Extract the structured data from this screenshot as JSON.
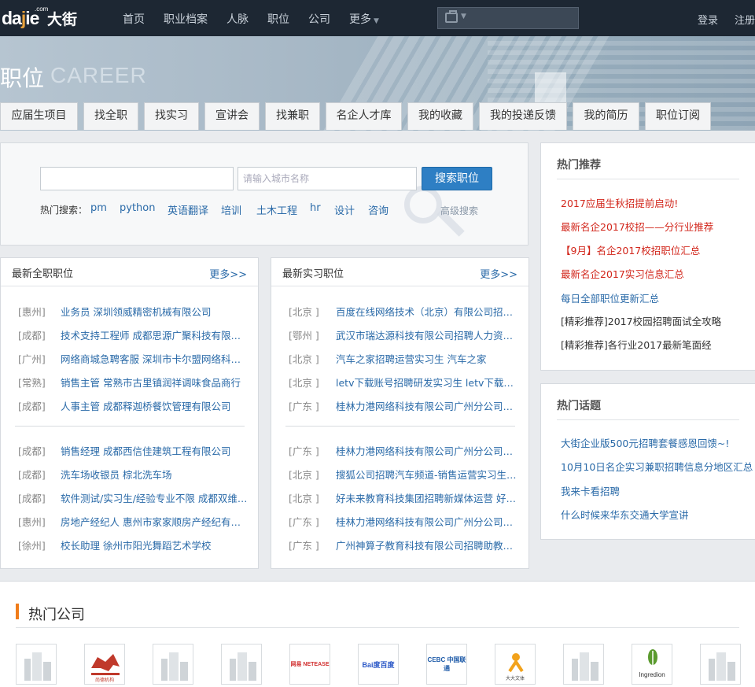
{
  "header": {
    "logo_en": "dajie",
    "logo_com": ".com",
    "logo_cn": "大街",
    "nav": [
      "首页",
      "职业档案",
      "人脉",
      "职位",
      "公司",
      "更多"
    ],
    "login": "登录",
    "register": "注册"
  },
  "banner": {
    "title": "职位",
    "subtitle": "CAREER",
    "tabs": [
      "应届生项目",
      "找全职",
      "找实习",
      "宣讲会",
      "找兼职",
      "名企人才库",
      "我的收藏",
      "我的投递反馈",
      "我的简历",
      "职位订阅"
    ]
  },
  "search": {
    "city_placeholder": "请输入城市名称",
    "button": "搜索职位",
    "hot_label": "热门搜索：",
    "hot_keywords": [
      "pm",
      "python",
      "英语翻译",
      "培训",
      "土木工程",
      "hr",
      "设计",
      "咨询"
    ],
    "advanced": "高级搜索"
  },
  "fulltime": {
    "title": "最新全职职位",
    "more": "更多>>",
    "rows": [
      {
        "city": "[惠州]",
        "job": "业务员  深圳领威精密机械有限公司"
      },
      {
        "city": "[成都]",
        "job": "技术支持工程师  成都思源广聚科技有限公司"
      },
      {
        "city": "[广州]",
        "job": "网络商城急聘客服  深圳市卡尔盟网络科技有限公司"
      },
      {
        "city": "[常熟]",
        "job": "销售主管  常熟市古里镇润祥调味食品商行"
      },
      {
        "city": "[成都]",
        "job": "人事主管  成都释迦桥餐饮管理有限公司"
      },
      {
        "city": "[成都]",
        "job": "销售经理  成都西信佳建筑工程有限公司"
      },
      {
        "city": "[成都]",
        "job": "洗车场收银员  棕北洗车场"
      },
      {
        "city": "[成都]",
        "job": "软件测试/实习生/经验专业不限  成都双维科技有限公司"
      },
      {
        "city": "[惠州]",
        "job": "房地产经纪人  惠州市家家顺房产经纪有限公司"
      },
      {
        "city": "[徐州]",
        "job": "校长助理  徐州市阳光舞蹈艺术学校"
      }
    ]
  },
  "intern": {
    "title": "最新实习职位",
    "more": "更多>>",
    "rows": [
      {
        "city": "[北京 ]",
        "job": "百度在线网络技术（北京）有限公司招聘实习生"
      },
      {
        "city": "[鄂州 ]",
        "job": "武汉市瑞达源科技有限公司招聘人力资源实习生"
      },
      {
        "city": "[北京 ]",
        "job": "汽车之家招聘运营实习生  汽车之家"
      },
      {
        "city": "[北京 ]",
        "job": "letv下载账号招聘研发实习生  letv下载账号"
      },
      {
        "city": "[广东 ]",
        "job": "桂林力港网络科技有限公司广州分公司招聘实习生"
      },
      {
        "city": "[广东 ]",
        "job": "桂林力港网络科技有限公司广州分公司招聘实习生"
      },
      {
        "city": "[北京 ]",
        "job": "搜狐公司招聘汽车频道-销售运营实习生  搜狐公司"
      },
      {
        "city": "[北京 ]",
        "job": "好未来教育科技集团招聘新媒体运营  好未来教育"
      },
      {
        "city": "[广东 ]",
        "job": "桂林力港网络科技有限公司广州分公司招聘实习生"
      },
      {
        "city": "[广东 ]",
        "job": "广州神算子教育科技有限公司招聘助教实习生"
      }
    ]
  },
  "recommend": {
    "title": "热门推荐",
    "items": [
      {
        "text": "2017应届生秋招提前启动!",
        "color": "#d2261b"
      },
      {
        "text": "最新名企2017校招——分行业推荐",
        "color": "#d2261b"
      },
      {
        "text": "【9月】名企2017校招职位汇总",
        "color": "#d2261b"
      },
      {
        "text": "最新名企2017实习信息汇总",
        "color": "#d2261b"
      },
      {
        "text": "每日全部职位更新汇总",
        "color": "#2a6aa8"
      },
      {
        "text": "[精彩推荐]2017校园招聘面试全攻略",
        "color": "#333333"
      },
      {
        "text": "[精彩推荐]各行业2017最新笔面经",
        "color": "#333333"
      }
    ]
  },
  "topics": {
    "title": "热门话题",
    "items": [
      "大街企业版500元招聘套餐感恩回馈~!",
      "10月10日名企实习兼职招聘信息分地区汇总",
      "我来卡看招聘",
      "什么时候来华东交通大学宣讲"
    ]
  },
  "companies": {
    "title": "热门公司",
    "logos": [
      {
        "icon": "building-placeholder-icon"
      },
      {
        "icon": "company-logo",
        "text": "尚德机构"
      },
      {
        "icon": "building-placeholder-icon"
      },
      {
        "icon": "building-placeholder-icon"
      },
      {
        "icon": "company-logo",
        "text": "网易 NETEASE"
      },
      {
        "icon": "company-logo",
        "text": "Bai度百度"
      },
      {
        "icon": "company-logo",
        "text": "CEBC 中国联通"
      },
      {
        "icon": "company-logo",
        "text": "大大文体"
      },
      {
        "icon": "building-placeholder-icon"
      },
      {
        "icon": "company-logo",
        "text": "Ingredion"
      },
      {
        "icon": "building-placeholder-icon"
      }
    ]
  }
}
